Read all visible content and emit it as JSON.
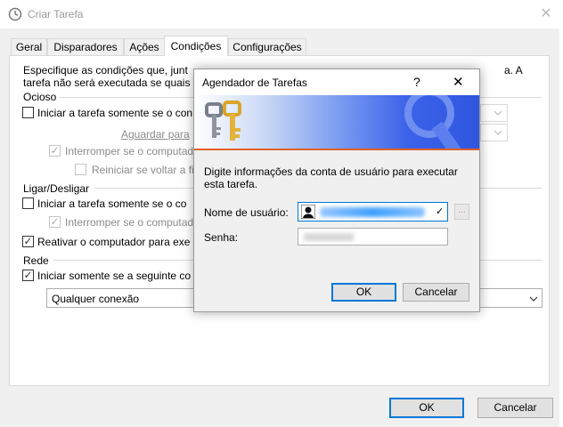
{
  "window": {
    "title": "Criar Tarefa",
    "close_glyph": "✕",
    "icon": "clock-icon"
  },
  "tabs": [
    {
      "label": "Geral"
    },
    {
      "label": "Disparadores"
    },
    {
      "label": "Ações"
    },
    {
      "label": "Condições"
    },
    {
      "label": "Configurações"
    }
  ],
  "conditions": {
    "intro_line1": "Especifique as condições que, junt",
    "intro_line1_tail": "a. A",
    "intro_line2": "tarefa não será executada se quais",
    "idle": {
      "group_label": "Ocioso",
      "start_only_if": "Iniciar a tarefa somente se o con",
      "wait_for": "Aguardar para",
      "stop_if": "Interromper se o computad",
      "restart_if": "Reiniciar se voltar a fi"
    },
    "power": {
      "group_label": "Ligar/Desligar",
      "start_only_if": "Iniciar a tarefa somente se o co",
      "stop_if": "Interromper se o computad",
      "wake": "Reativar o computador para exe"
    },
    "network": {
      "group_label": "Rede",
      "start_only_if": "Iniciar somente se a seguinte co",
      "connection_value": "Qualquer conexão"
    }
  },
  "footer": {
    "ok": "OK",
    "cancel": "Cancelar"
  },
  "dialog": {
    "title": "Agendador de Tarefas",
    "help_glyph": "?",
    "close_glyph": "✕",
    "instruction": "Digite informações da conta de usuário para executar esta tarefa.",
    "username_label": "Nome de usuário:",
    "password_label": "Senha:",
    "browse_glyph": "...",
    "ok": "OK",
    "cancel": "Cancelar",
    "banner_icon": "keys-icon",
    "user_icon": "user-icon"
  }
}
